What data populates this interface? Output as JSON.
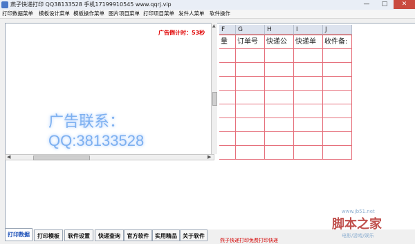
{
  "window": {
    "title": "燕子快递打印   QQ38133528  手机17199910545  www.qqrj.vip",
    "min_label": "—",
    "max_label": "□",
    "close_label": "✕"
  },
  "menu": [
    "打印数据菜单",
    "模板设计菜单",
    "模板操作菜单",
    "图片项目菜单",
    "打印项目菜单",
    "发件人菜单",
    "软件操作"
  ],
  "countdown": "广告倒计时：53秒",
  "ad": {
    "line1": "广告联系：",
    "line2": "QQ:38133528"
  },
  "grid": {
    "columns": [
      {
        "letter": "F",
        "header": "量"
      },
      {
        "letter": "G",
        "header": "订单号"
      },
      {
        "letter": "H",
        "header": "快递公"
      },
      {
        "letter": "I",
        "header": "快递单"
      },
      {
        "letter": "J",
        "header": "收件备:"
      }
    ]
  },
  "tabs": [
    "打印数据",
    "打印模板",
    "软件设置",
    "快递查询",
    "官方软件",
    "实用精品",
    "关于软件"
  ],
  "active_tab": 0,
  "status": "燕子快递打印免费打印快递",
  "watermark": {
    "url": "www.jb51.net",
    "brand": "脚本之家",
    "sub": "电影/游戏/娱乐"
  }
}
